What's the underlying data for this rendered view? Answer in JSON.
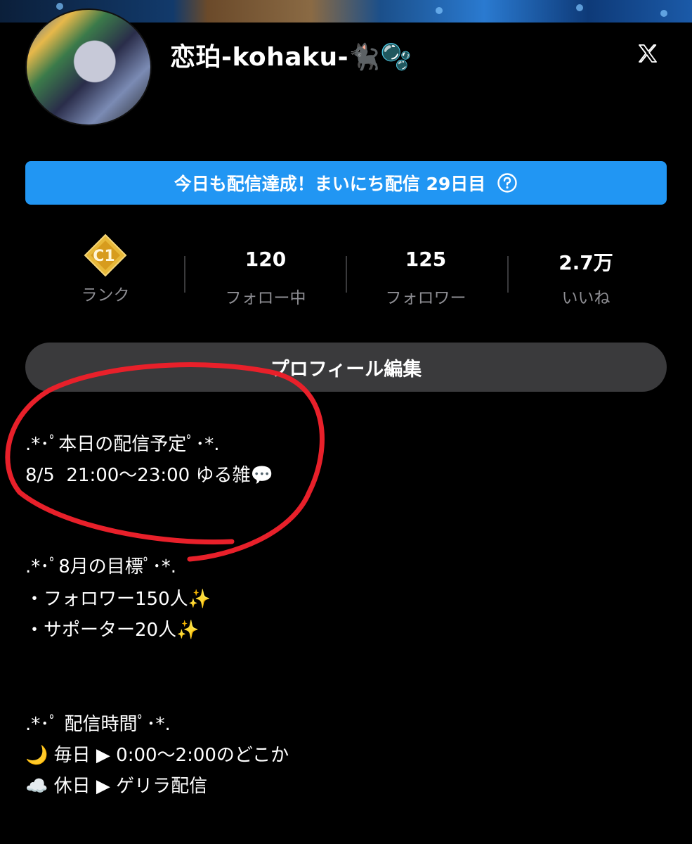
{
  "profile": {
    "username": "恋珀-kohaku-🐈‍⬛🫧",
    "x_icon": "x-logo-icon"
  },
  "streak_banner": {
    "text": "今日も配信達成！まいにち配信 29日目",
    "help_icon": "question-circle-icon"
  },
  "stats": {
    "rank": {
      "badge": "C1",
      "label": "ランク"
    },
    "following": {
      "value": "120",
      "label": "フォロー中"
    },
    "followers": {
      "value": "125",
      "label": "フォロワー"
    },
    "likes": {
      "value": "2.7万",
      "label": "いいね"
    }
  },
  "edit_button": {
    "label": "プロフィール編集"
  },
  "bio": {
    "schedule_title": ".*･ﾟ本日の配信予定ﾟ･*.",
    "schedule_line": "8/5  21:00〜23:00 ゆる雑💬",
    "goal_title": ".*･ﾟ8月の目標ﾟ･*.",
    "goal_1": "・フォロワー150人✨",
    "goal_2": "・サポーター20人✨",
    "time_title": ".*･ﾟ 配信時間ﾟ･*.",
    "time_1": "🌙 毎日 ▶ 0:00〜2:00のどこか",
    "time_2": "☁️ 休日 ▶ ゲリラ配信"
  },
  "annotation_color": "#e8202a",
  "accent_color": "#2196f3"
}
